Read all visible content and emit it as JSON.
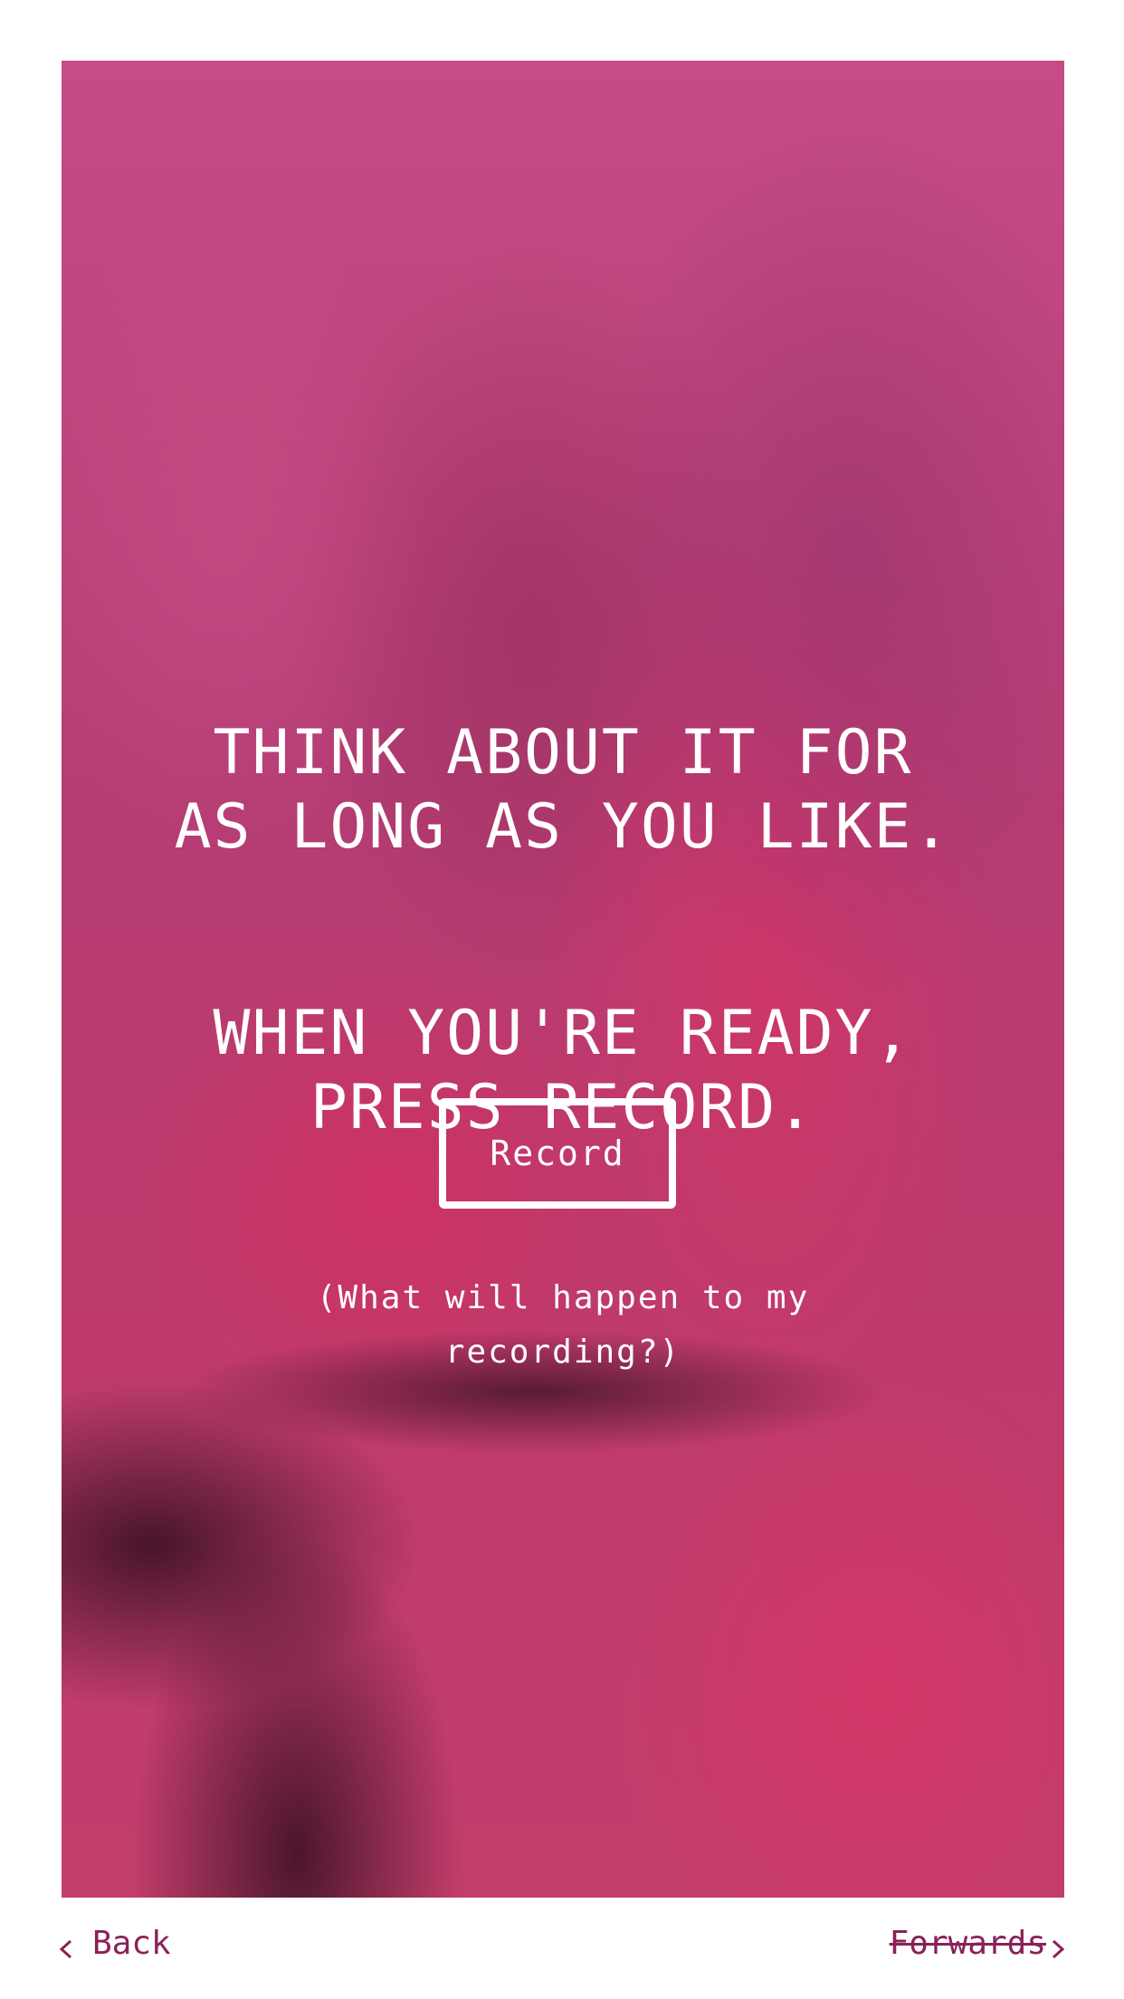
{
  "card": {
    "headline_line1": "THINK ABOUT IT FOR AS LONG AS YOU LIKE.",
    "headline_line2": "WHEN YOU'RE READY, PRESS RECORD.",
    "record_label": "Record",
    "info_link": "(What will happen to my recording?)"
  },
  "nav": {
    "back_label": "Back",
    "forwards_label": "Forwards",
    "back_icon": "chevron-left-icon",
    "forwards_icon": "chevron-right-icon",
    "color": "#8a2158"
  }
}
